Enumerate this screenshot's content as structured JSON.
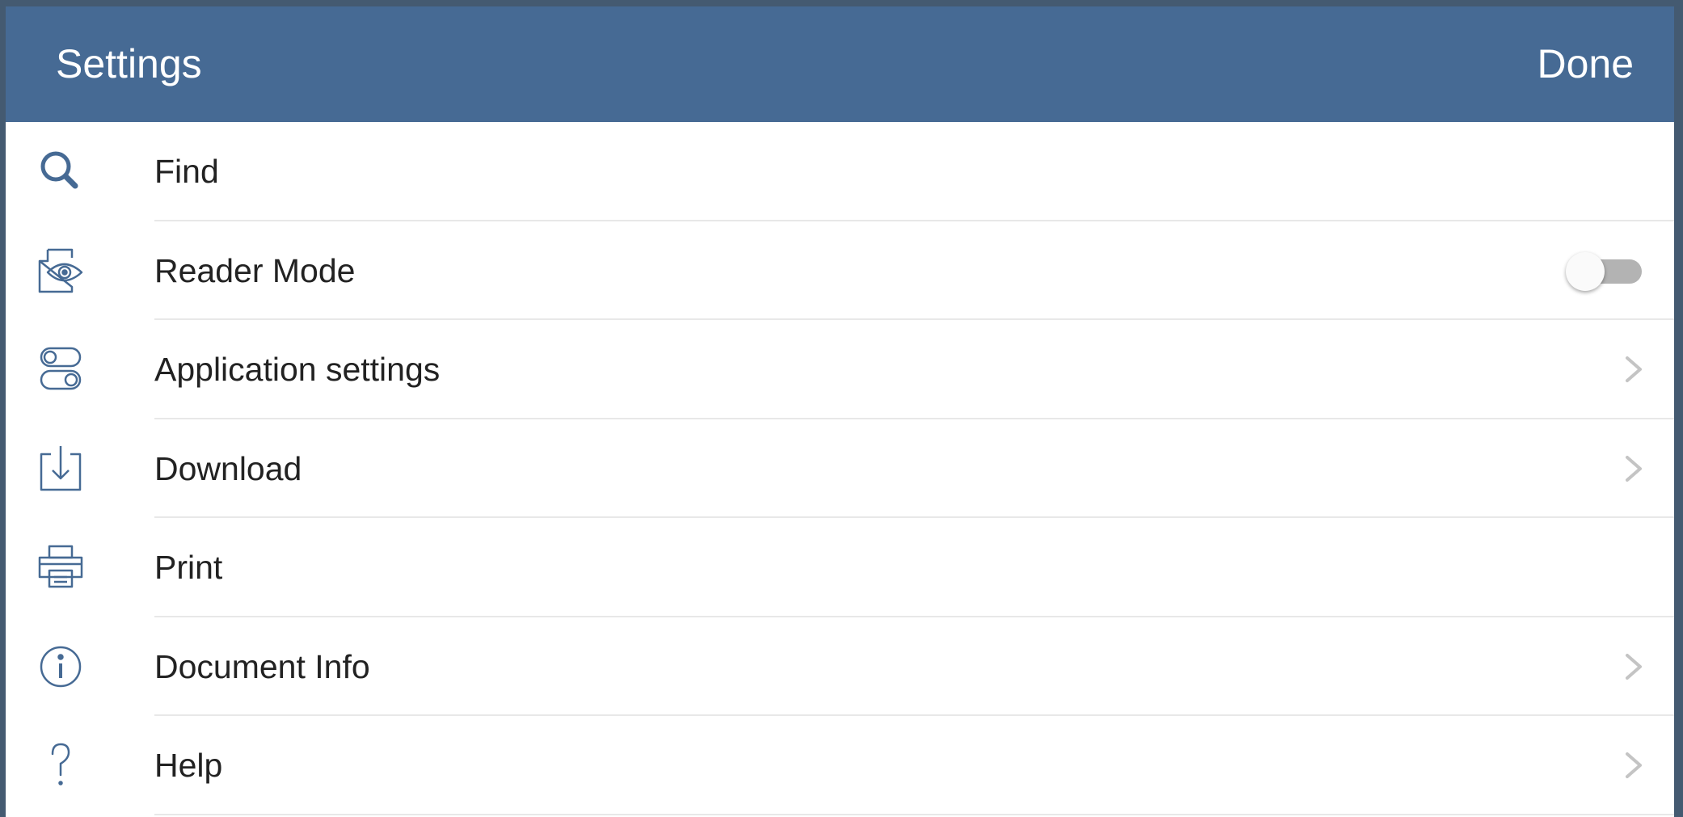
{
  "header": {
    "title": "Settings",
    "done_label": "Done",
    "background_color": "#466a94"
  },
  "menu": {
    "icon_color": "#466a94",
    "items": [
      {
        "label": "Find",
        "icon": "search-icon",
        "trailing": "none"
      },
      {
        "label": "Reader Mode",
        "icon": "reader-mode-icon",
        "trailing": "toggle",
        "toggle_on": false
      },
      {
        "label": "Application settings",
        "icon": "settings-toggles-icon",
        "trailing": "chevron"
      },
      {
        "label": "Download",
        "icon": "download-icon",
        "trailing": "chevron"
      },
      {
        "label": "Print",
        "icon": "printer-icon",
        "trailing": "none"
      },
      {
        "label": "Document Info",
        "icon": "info-icon",
        "trailing": "chevron"
      },
      {
        "label": "Help",
        "icon": "help-icon",
        "trailing": "chevron"
      }
    ]
  }
}
